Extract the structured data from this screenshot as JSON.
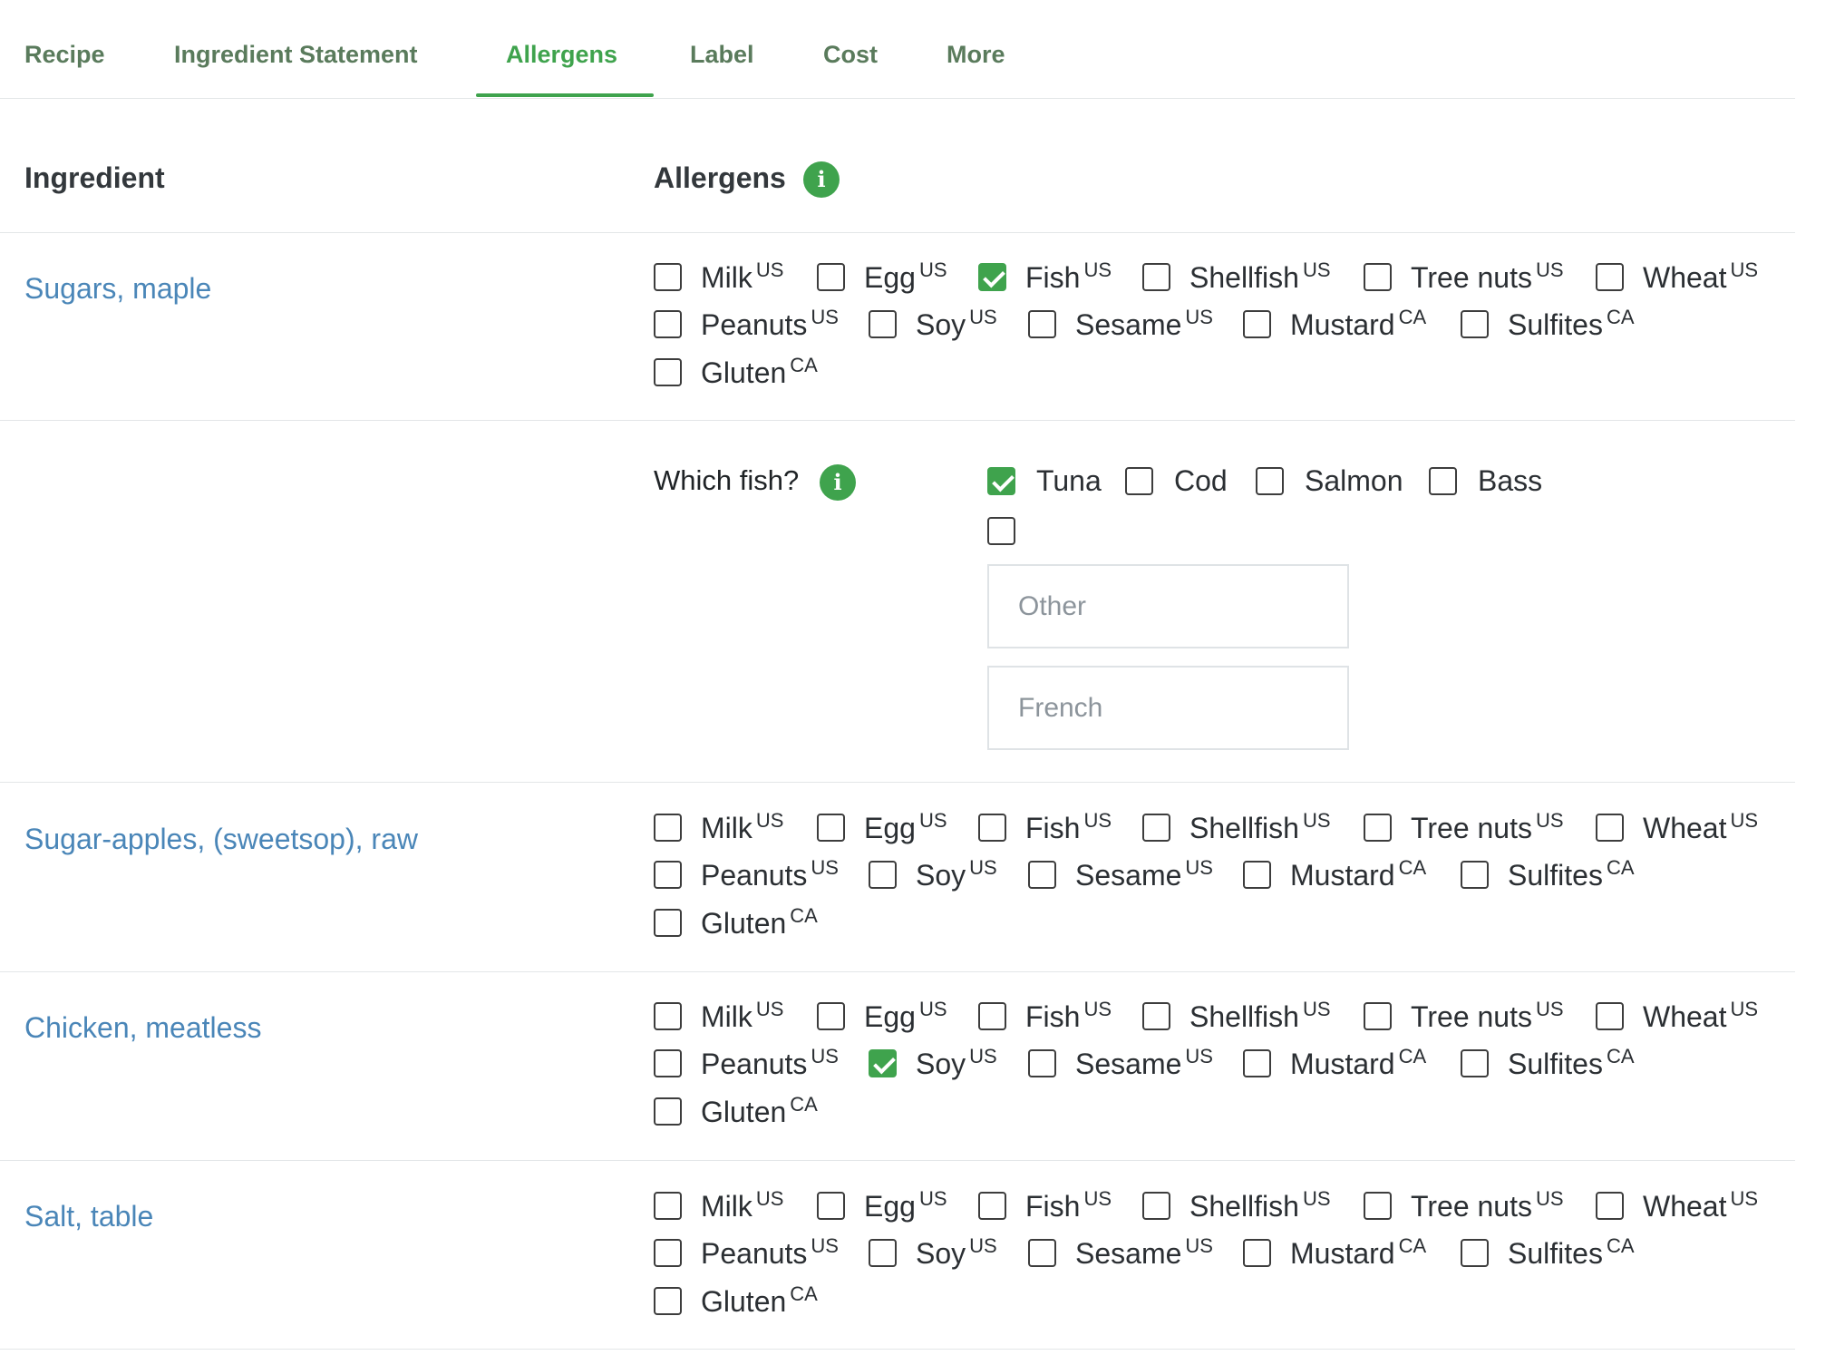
{
  "tabs": [
    {
      "label": "Recipe",
      "active": false
    },
    {
      "label": "Ingredient Statement",
      "active": false
    },
    {
      "label": "Allergens",
      "active": true
    },
    {
      "label": "Label",
      "active": false
    },
    {
      "label": "Cost",
      "active": false
    },
    {
      "label": "More",
      "active": false
    }
  ],
  "header": {
    "ingredient": "Ingredient",
    "allergens": "Allergens",
    "info_icon": "i"
  },
  "allergen_options": [
    {
      "name": "Milk",
      "region": "US"
    },
    {
      "name": "Egg",
      "region": "US"
    },
    {
      "name": "Fish",
      "region": "US"
    },
    {
      "name": "Shellfish",
      "region": "US"
    },
    {
      "name": "Tree nuts",
      "region": "US"
    },
    {
      "name": "Wheat",
      "region": "US"
    },
    {
      "name": "Peanuts",
      "region": "US"
    },
    {
      "name": "Soy",
      "region": "US"
    },
    {
      "name": "Sesame",
      "region": "US"
    },
    {
      "name": "Mustard",
      "region": "CA"
    },
    {
      "name": "Sulfites",
      "region": "CA"
    },
    {
      "name": "Gluten",
      "region": "CA"
    }
  ],
  "ingredients": [
    {
      "name": "Sugars, maple",
      "checked": [
        "Fish"
      ]
    },
    {
      "name": "Sugar-apples, (sweetsop), raw",
      "checked": []
    },
    {
      "name": "Chicken, meatless",
      "checked": [
        "Soy"
      ]
    },
    {
      "name": "Salt, table",
      "checked": []
    }
  ],
  "fish_question": {
    "label": "Which fish?",
    "info_icon": "i",
    "options": [
      {
        "name": "Tuna",
        "checked": true
      },
      {
        "name": "Cod",
        "checked": false
      },
      {
        "name": "Salmon",
        "checked": false
      },
      {
        "name": "Bass",
        "checked": false
      }
    ],
    "other_checked": false,
    "other_placeholder": "Other",
    "french_placeholder": "French"
  },
  "colors": {
    "accent": "#3fa34d",
    "link": "#4a86b8",
    "tab_text": "#5a7b5c"
  }
}
